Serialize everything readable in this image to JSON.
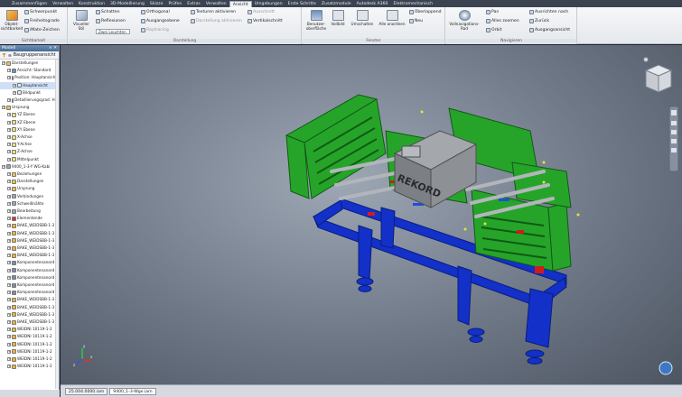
{
  "ribbon_tabs": [
    "Zusammenfügen",
    "Verwalten",
    "Konstruktion",
    "3D-Modellierung",
    "Skizze",
    "Prüfen",
    "Extras",
    "Verwalten",
    "Ansicht",
    "Umgebungen",
    "Erste Schritte",
    "Zusatzmodule",
    "Autodesk A360",
    "Elektromechanisch"
  ],
  "ribbon_active_index": 8,
  "panels": {
    "sichtbarkeit": {
      "title": "Sichtbarkeit",
      "objekt": "Objekt-\nsichtbarkeit",
      "schwerpunkt": "Schwerpunkt",
      "freiheitsgrade": "Freiheitsgrade",
      "imate": "iMate-Zeichen"
    },
    "darstellung": {
      "title": "Darstellung",
      "visueller_stil": "Visueller Stil",
      "schatten": "Schatten",
      "reflexionen": "Reflexionen",
      "lighting": "Zwei Leuchten",
      "orthogonal": "Orthogonal",
      "ausgangsebene": "Ausgangsebene",
      "raytracing": "Raytracing",
      "textur": "Texturen aktivieren",
      "farbe": "Darstellung aktivieren",
      "ausschnitt": "Ausschnitt",
      "vertikal": "Vertikalschnitt"
    },
    "fenster": {
      "title": "Fenster",
      "benutzeroberflaeche": "Benutzer-\noberfläche",
      "vollbild": "Vollbild",
      "umschalten": "Umschalten",
      "alle_anordnen": "Alle anordnen",
      "ueberlappend": "Überlappend",
      "neu": "Neu"
    },
    "navigieren": {
      "title": "Navigieren",
      "vollnavigation": "Vollnavigations-\nRad",
      "pan": "Pan",
      "alles_zoomen": "Alles zoomen",
      "orbit": "Orbit",
      "ausrichten": "Ausrichten nach",
      "zurueck": "Zurück",
      "ausgangsansicht": "Ausgangsansicht"
    }
  },
  "browser": {
    "title": "Modell",
    "root": "Baugruppenansicht",
    "items": [
      {
        "depth": 0,
        "label": "Darstellungen",
        "icon": "folder"
      },
      {
        "depth": 1,
        "label": "Ansicht: Standard",
        "icon": "view"
      },
      {
        "depth": 1,
        "label": "Position: Hauptansicht",
        "icon": "view"
      },
      {
        "depth": 2,
        "label": "Hauptansicht",
        "icon": "doc",
        "selected": true
      },
      {
        "depth": 2,
        "label": "Bildpunkt",
        "icon": "doc"
      },
      {
        "depth": 1,
        "label": "Detaillierungsgrad: Ha",
        "icon": "view"
      },
      {
        "depth": 0,
        "label": "Ursprung",
        "icon": "folder"
      },
      {
        "depth": 1,
        "label": "YZ Ebene",
        "icon": "plane"
      },
      {
        "depth": 1,
        "label": "XZ Ebene",
        "icon": "plane"
      },
      {
        "depth": 1,
        "label": "XY Ebene",
        "icon": "plane"
      },
      {
        "depth": 1,
        "label": "X-Achse",
        "icon": "plane"
      },
      {
        "depth": 1,
        "label": "Y-Achse",
        "icon": "plane"
      },
      {
        "depth": 1,
        "label": "Z-Achse",
        "icon": "plane"
      },
      {
        "depth": 1,
        "label": "Mittelpunkt",
        "icon": "point"
      },
      {
        "depth": 0,
        "label": "9400_1-3-Y WG-Kabi",
        "icon": "asm"
      },
      {
        "depth": 1,
        "label": "Beziehungen",
        "icon": "folder"
      },
      {
        "depth": 1,
        "label": "Darstellungen",
        "icon": "folder"
      },
      {
        "depth": 1,
        "label": "Ursprung",
        "icon": "folder"
      },
      {
        "depth": 1,
        "label": "Verbindungen",
        "icon": "asm"
      },
      {
        "depth": 1,
        "label": "Schweißnähte",
        "icon": "asm"
      },
      {
        "depth": 1,
        "label": "Bearbeitung",
        "icon": "asm"
      },
      {
        "depth": 1,
        "label": "Elementende",
        "icon": "red"
      },
      {
        "depth": 1,
        "label": "BAKE_WEIDSBB-1-3",
        "icon": "part"
      },
      {
        "depth": 1,
        "label": "BAKE_WEIDSBB-1-3",
        "icon": "part"
      },
      {
        "depth": 1,
        "label": "BAKE_WEIDSBB-1-3",
        "icon": "part"
      },
      {
        "depth": 1,
        "label": "BAKE_WEIDSBB-1-3",
        "icon": "part"
      },
      {
        "depth": 1,
        "label": "BAKE_WEIDSBB-1-3",
        "icon": "part"
      },
      {
        "depth": 1,
        "label": "Komponentenanord",
        "icon": "pattern"
      },
      {
        "depth": 1,
        "label": "Komponentenanord",
        "icon": "pattern"
      },
      {
        "depth": 1,
        "label": "Komponentenanord",
        "icon": "pattern"
      },
      {
        "depth": 1,
        "label": "Komponentenanord",
        "icon": "pattern"
      },
      {
        "depth": 1,
        "label": "Komponentenanord",
        "icon": "pattern"
      },
      {
        "depth": 1,
        "label": "BAKE_WEIDSBB-1-3",
        "icon": "part"
      },
      {
        "depth": 1,
        "label": "BAKE_WEIDSBB-1-3",
        "icon": "part"
      },
      {
        "depth": 1,
        "label": "BAKE_WEIDSBB-1-3",
        "icon": "part"
      },
      {
        "depth": 1,
        "label": "BAKE_WEIDSBB-1-3",
        "icon": "part"
      },
      {
        "depth": 1,
        "label": "WEIDNI 10119-1-2",
        "icon": "part"
      },
      {
        "depth": 1,
        "label": "WEIDNI 10119-1-2",
        "icon": "part"
      },
      {
        "depth": 1,
        "label": "WEIDNI 10119-1-2",
        "icon": "part"
      },
      {
        "depth": 1,
        "label": "WEIDNI 10119-1-2",
        "icon": "part"
      },
      {
        "depth": 1,
        "label": "WEIDNI 10119-1-2",
        "icon": "part"
      },
      {
        "depth": 1,
        "label": "WEIDNI 10119-1-2",
        "icon": "part"
      }
    ]
  },
  "viewport": {
    "viewcube": "viewcube",
    "model_label": "REKORD",
    "axis_labels": {
      "x": "x",
      "y": "y",
      "z": "z"
    }
  },
  "doc_tabs": [
    "25.004.0000.iam",
    "9400_1-3-Wge.iam"
  ],
  "doc_tab_active": 1,
  "colors": {
    "green_frame": "#26a42a",
    "blue_base": "#1330c8",
    "gray_box": "#8a8d91",
    "ribbon_bg": "#eceef1"
  }
}
